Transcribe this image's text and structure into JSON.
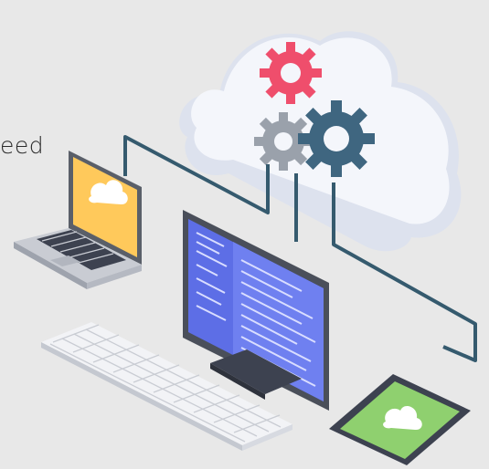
{
  "headline": {
    "cut_text": "eed"
  },
  "icons": {
    "cloud": "cloud-icon",
    "gear_red": "gear-icon",
    "gear_gray": "gear-icon",
    "gear_blue": "gear-icon"
  },
  "colors": {
    "background": "#e8e8e8",
    "cloud": "#f0f2f8",
    "gear_red": "#ef4e6c",
    "gear_gray": "#9aa1ab",
    "gear_blue": "#3f6680",
    "wire": "#355a6e",
    "laptop_screen": "#ffc95b",
    "monitor_screen": "#5d6ee6",
    "tablet_screen": "#8fd06f"
  }
}
